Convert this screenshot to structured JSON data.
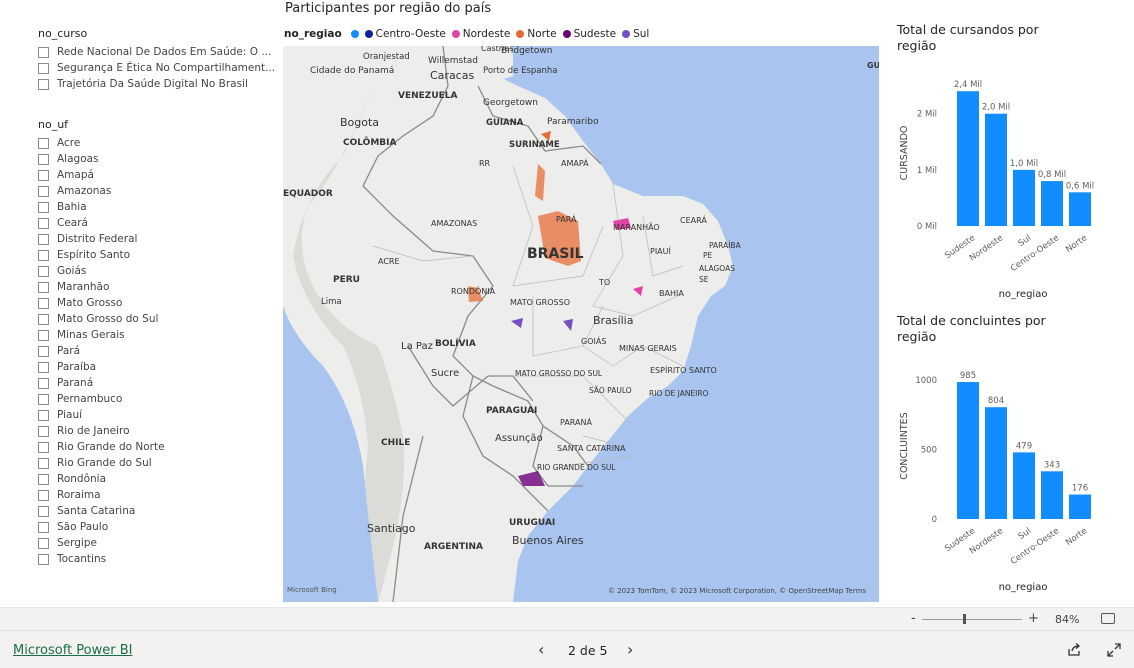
{
  "slicers": {
    "curso": {
      "title": "no_curso",
      "items": [
        "Rede Nacional De Dados Em Saúde: O ...",
        "Segurança E Ética No Compartilhament...",
        "Trajetória Da Saúde Digital No Brasil"
      ]
    },
    "uf": {
      "title": "no_uf",
      "items": [
        "Acre",
        "Alagoas",
        "Amapá",
        "Amazonas",
        "Bahia",
        "Ceará",
        "Distrito Federal",
        "Espírito Santo",
        "Goiás",
        "Maranhão",
        "Mato Grosso",
        "Mato Grosso do Sul",
        "Minas Gerais",
        "Pará",
        "Paraíba",
        "Paraná",
        "Pernambuco",
        "Piauí",
        "Rio de Janeiro",
        "Rio Grande do Norte",
        "Rio Grande do Sul",
        "Rondônia",
        "Roraima",
        "Santa Catarina",
        "São Paulo",
        "Sergipe",
        "Tocantins"
      ]
    }
  },
  "map": {
    "title": "Participantes por região do país",
    "legend_title": "no_regiao",
    "legend": [
      {
        "label": "",
        "color": "#118dff"
      },
      {
        "label": "Centro-Oeste",
        "color": "#12239e"
      },
      {
        "label": "Nordeste",
        "color": "#e044a7"
      },
      {
        "label": "Norte",
        "color": "#e66c37"
      },
      {
        "label": "Sudeste",
        "color": "#6b007b"
      },
      {
        "label": "Sul",
        "color": "#744ec2"
      }
    ],
    "labels": {
      "brasil": "BRASIL",
      "brasilia": "Brasília",
      "bogota": "Bogota",
      "colombia": "COLÔMBIA",
      "venezuela": "VENEZUELA",
      "caracas": "Caracas",
      "equador": "EQUADOR",
      "peru": "PERU",
      "lima": "Lima",
      "bolivia": "BOLÍVIA",
      "lapaz": "La Paz",
      "sucre": "Sucre",
      "paraguai": "PARAGUAI",
      "assuncao": "Assunção",
      "chile": "CHILE",
      "santiago": "Santiago",
      "argentina": "ARGENTINA",
      "buenosaires": "Buenos Aires",
      "uruguai": "URUGUAI",
      "guiana": "GUIANA",
      "suriname": "SURINAME",
      "georgetown": "Georgetown",
      "paramaribo": "Paramaribo",
      "amazonas": "AMAZONAS",
      "para": "PARÁ",
      "acre": "ACRE",
      "rondonia": "RONDÔNIA",
      "matogrosso": "MATO GROSSO",
      "to": "TO",
      "goias": "GOIÁS",
      "minasgerais": "MINAS GERAIS",
      "espiritosanto": "ESPÍRITO SANTO",
      "riodejaneiro": "RIO DE JANEIRO",
      "saopaulo": "SÃO PAULO",
      "parana": "PARANÁ",
      "santacatarina": "SANTA CATARINA",
      "riograndedosul": "RIO GRANDE DO SUL",
      "msul": "MATO GROSSO DO SUL",
      "bahia": "BAHIA",
      "maranhao": "MARANHÃO",
      "piaui": "PIAUÍ",
      "ceara": "CEARÁ",
      "paraiba": "PARAÍBA",
      "pe": "PE",
      "alagoas": "ALAGOAS",
      "se": "SE",
      "rr": "RR",
      "amapa": "AMAPÁ",
      "cidadedopanama": "Cidade do Panamá",
      "oranjestad": "Oranjestad",
      "willemstad": "Willemstad",
      "portodeespanha": "Porto de Espanha",
      "castries": "Castries",
      "bridgetown": "Bridgetown",
      "gu": "GU"
    },
    "attribution": "© 2023 TomTom, © 2023 Microsoft Corporation, © OpenStreetMap  Terms",
    "bing": "Microsoft Bing"
  },
  "chart_data": [
    {
      "type": "bar",
      "title": "Total de cursandos por região",
      "xlabel": "no_regiao",
      "ylabel": "CURSANDO",
      "categories": [
        "Sudeste",
        "Nordeste",
        "Sul",
        "Centro-Oeste",
        "Norte"
      ],
      "values": [
        2.4,
        2.0,
        1.0,
        0.8,
        0.6
      ],
      "data_labels": [
        "2,4 Mil",
        "2,0 Mil",
        "1,0 Mil",
        "0,8 Mil",
        "0,6 Mil"
      ],
      "yticks": [
        "0 Mil",
        "1 Mil",
        "2 Mil"
      ],
      "ylim": [
        0,
        2.6
      ],
      "color": "#118dff"
    },
    {
      "type": "bar",
      "title": "Total de concluintes por região",
      "xlabel": "no_regiao",
      "ylabel": "CONCLUINTES",
      "categories": [
        "Sudeste",
        "Nordeste",
        "Sul",
        "Centro-Oeste",
        "Norte"
      ],
      "values": [
        985,
        804,
        479,
        343,
        176
      ],
      "data_labels": [
        "985",
        "804",
        "479",
        "343",
        "176"
      ],
      "yticks": [
        "0",
        "500",
        "1000"
      ],
      "ylim": [
        0,
        1050
      ],
      "color": "#118dff"
    }
  ],
  "zoom": {
    "minus": "-",
    "plus": "+",
    "value": "84%",
    "level": 0.84
  },
  "footer": {
    "brand": "Microsoft Power BI",
    "page": "2 de 5"
  }
}
